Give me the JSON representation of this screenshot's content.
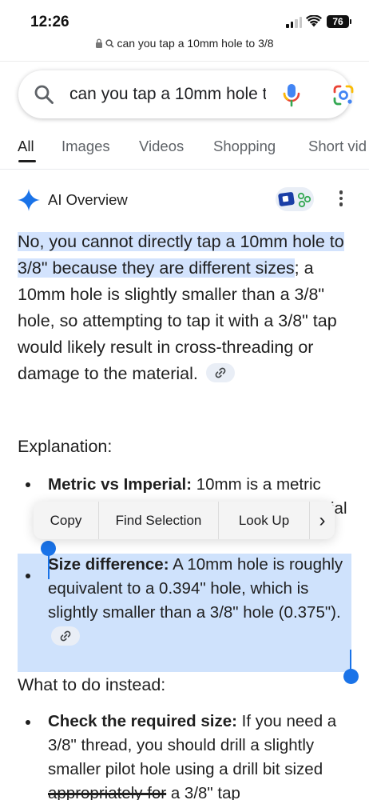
{
  "status": {
    "time": "12:26",
    "battery": "76"
  },
  "url": {
    "text": "can you tap a 10mm hole to 3/8"
  },
  "search": {
    "query": "can you tap a 10mm hole to 3/8"
  },
  "tabs": [
    "All",
    "Images",
    "Videos",
    "Shopping",
    "Short vid"
  ],
  "ai_overview": {
    "title": "AI Overview",
    "answer_bold": "No, you cannot directly tap a 10mm hole to 3/8\" because they are different sizes",
    "answer_rest": "; a 10mm hole is slightly smaller than a 3/8\" hole, so attempting to tap it with a 3/8\" tap would likely result in cross-threading or damage to the material."
  },
  "explanation": {
    "heading": "Explanation:",
    "item1_label": "Metric vs Imperial:",
    "item1_text": " 10mm is a metric",
    "item1_line2_partial": "ial",
    "item2_label": "Size difference:",
    "item2_text": " A 10mm hole is roughly equivalent to a 0.394\" hole, which is slightly smaller than a 3/8\" hole (0.375\")."
  },
  "todo": {
    "heading": "What to do instead:",
    "item1_label": "Check the required size:",
    "item1_text": " If you need a 3/8\" thread, you should drill a slightly smaller pilot hole using a drill bit sized ",
    "item1_strike": "appropriately for",
    "item1_tail": " a 3/8\" tap"
  },
  "context_menu": {
    "copy": "Copy",
    "find": "Find Selection",
    "lookup": "Look Up",
    "next": "›"
  },
  "colors": {
    "accent": "#1a73e8",
    "selection": "#d3e3fd"
  }
}
